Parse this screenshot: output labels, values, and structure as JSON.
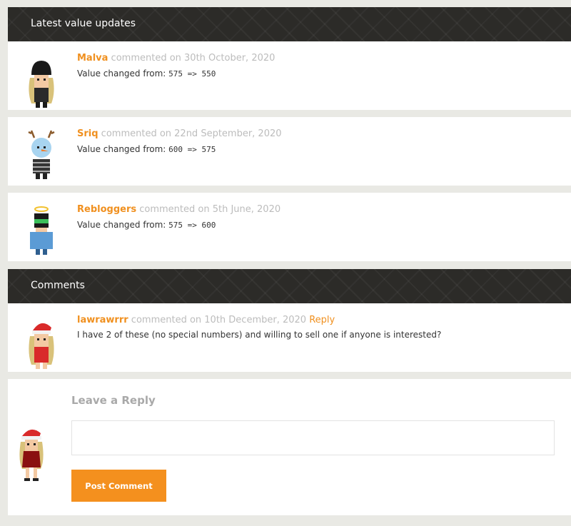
{
  "value_updates": {
    "title": "Latest value updates",
    "items": [
      {
        "user": "Malva",
        "action": " commented on 30th October, 2020",
        "text": "Value changed from: ",
        "change": "575 => 550"
      },
      {
        "user": "Sriq",
        "action": " commented on 22nd September, 2020",
        "text": "Value changed from: ",
        "change": "600 => 575"
      },
      {
        "user": "Rebloggers",
        "action": " commented on 5th June, 2020",
        "text": "Value changed from: ",
        "change": "575 => 600"
      }
    ]
  },
  "comments": {
    "title": "Comments",
    "items": [
      {
        "user": "lawrawrrr",
        "action": " commented on 10th December, 2020 ",
        "reply_label": "Reply",
        "text": "I have 2 of these (no special numbers) and willing to sell one if anyone is interested?"
      }
    ]
  },
  "reply_form": {
    "title": "Leave a Reply",
    "input_value": "",
    "submit_label": "Post Comment"
  },
  "colors": {
    "accent": "#f0901f",
    "banner": "#2c2b28",
    "muted": "#bcbcbc",
    "page_bg": "#e9e9e4"
  },
  "icons": {
    "avatars": [
      "avatar-black-hat",
      "avatar-snowman-antlers",
      "avatar-halo-helmet",
      "avatar-santa-hat",
      "avatar-santa-hat-full"
    ]
  }
}
